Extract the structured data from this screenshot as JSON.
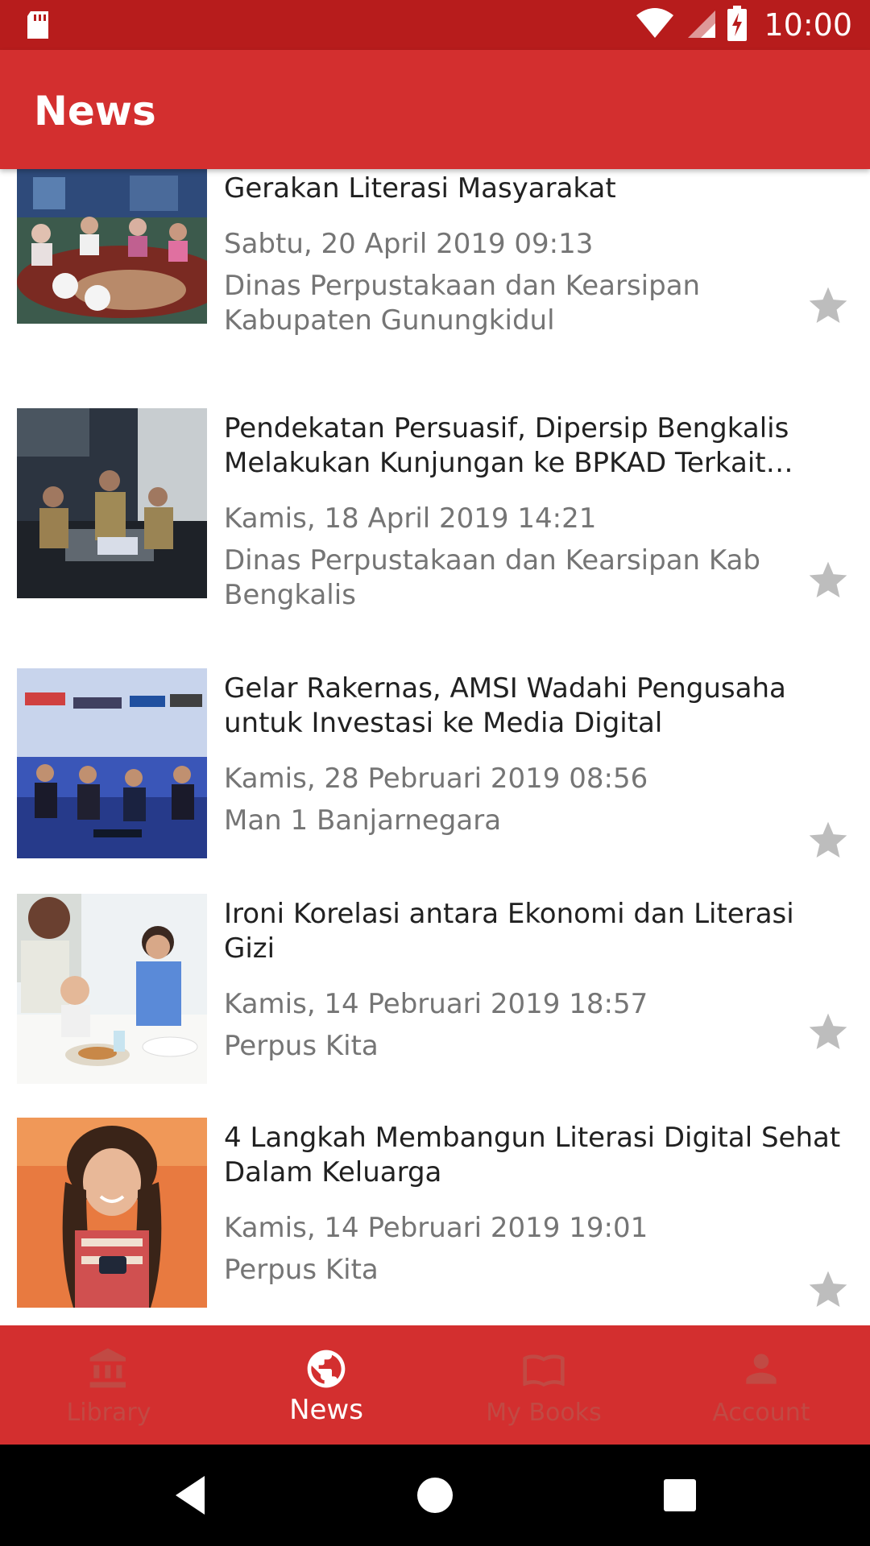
{
  "status_bar": {
    "time": "10:00",
    "icons": [
      "sd-card-icon",
      "wifi-icon",
      "cell-signal-icon",
      "battery-charging-icon"
    ]
  },
  "app_bar": {
    "title": "News"
  },
  "items": [
    {
      "title": "Klub Baca: Salah satu Solusi Peningkatan Gerakan Literasi Masyarakat",
      "date": "Sabtu, 20 April 2019 09:13",
      "source": "Dinas Perpustakaan dan Kearsipan Kabupaten Gunungkidul"
    },
    {
      "title": "Pendekatan Persuasif, Dipersip Bengkalis Melakukan Kunjungan ke BPKAD Terkait Arsip…",
      "date": "Kamis, 18 April 2019 14:21",
      "source": "Dinas Perpustakaan dan Kearsipan Kab Bengkalis"
    },
    {
      "title": "Gelar Rakernas, AMSI Wadahi Pengusaha untuk Investasi ke Media Digital",
      "date": "Kamis, 28 Pebruari 2019 08:56",
      "source": "Man 1 Banjarnegara"
    },
    {
      "title": "Ironi Korelasi antara Ekonomi dan Literasi Gizi",
      "date": "Kamis, 14 Pebruari 2019 18:57",
      "source": "Perpus Kita"
    },
    {
      "title": "4 Langkah Membangun Literasi Digital Sehat Dalam Keluarga",
      "date": "Kamis, 14 Pebruari 2019 19:01",
      "source": "Perpus Kita"
    }
  ],
  "bottom_nav": [
    {
      "label": "Library",
      "icon": "library-icon",
      "active": false
    },
    {
      "label": "News",
      "icon": "globe-icon",
      "active": true
    },
    {
      "label": "My Books",
      "icon": "book-icon",
      "active": false
    },
    {
      "label": "Account",
      "icon": "person-icon",
      "active": false
    }
  ],
  "colors": {
    "primary": "#d32f2f",
    "primary_dark": "#b71c1c",
    "inactive_nav": "#c14a44",
    "star": "#bdbdbd"
  }
}
